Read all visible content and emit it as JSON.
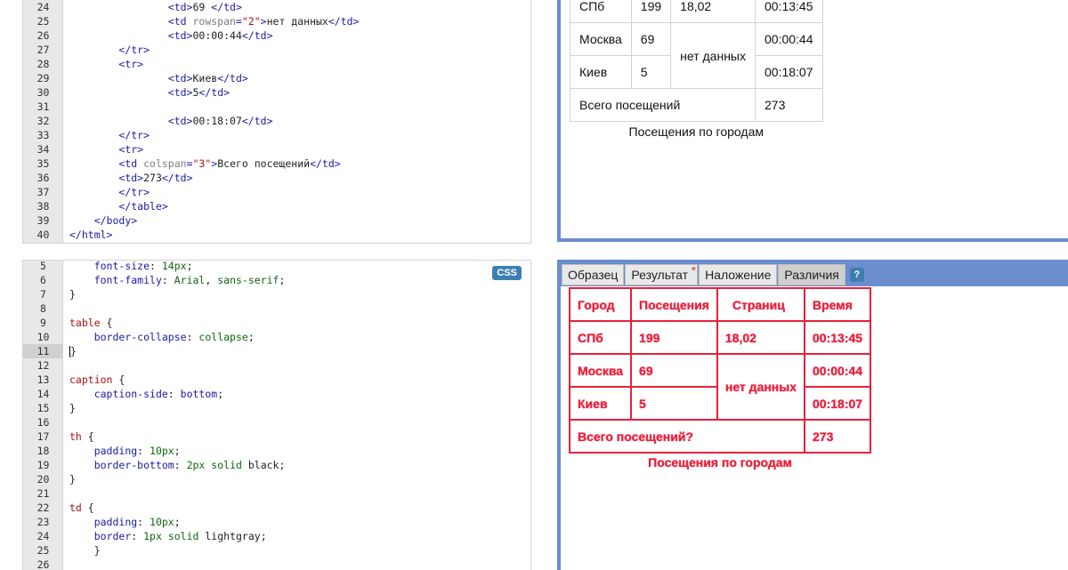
{
  "html_editor": {
    "lines": [
      {
        "n": "24",
        "indent": 4,
        "tokens": [
          [
            "tag",
            "<td>"
          ],
          [
            "text",
            "69 "
          ],
          [
            "tag",
            "</td>"
          ]
        ]
      },
      {
        "n": "25",
        "indent": 4,
        "tokens": [
          [
            "tag",
            "<td "
          ],
          [
            "attr",
            "rowspan"
          ],
          [
            "tag",
            "="
          ],
          [
            "str",
            "\"2\""
          ],
          [
            "tag",
            ">"
          ],
          [
            "text",
            "нет данных"
          ],
          [
            "tag",
            "</td>"
          ]
        ]
      },
      {
        "n": "26",
        "indent": 4,
        "tokens": [
          [
            "tag",
            "<td>"
          ],
          [
            "text",
            "00:00:44"
          ],
          [
            "tag",
            "</td>"
          ]
        ]
      },
      {
        "n": "27",
        "indent": 2,
        "tokens": [
          [
            "tag",
            "</tr>"
          ]
        ]
      },
      {
        "n": "28",
        "indent": 2,
        "tokens": [
          [
            "tag",
            "<tr>"
          ]
        ]
      },
      {
        "n": "29",
        "indent": 4,
        "tokens": [
          [
            "tag",
            "<td>"
          ],
          [
            "text",
            "Киев"
          ],
          [
            "tag",
            "</td>"
          ]
        ]
      },
      {
        "n": "30",
        "indent": 4,
        "tokens": [
          [
            "tag",
            "<td>"
          ],
          [
            "text",
            "5"
          ],
          [
            "tag",
            "</td>"
          ]
        ]
      },
      {
        "n": "31",
        "indent": 0,
        "tokens": []
      },
      {
        "n": "32",
        "indent": 4,
        "tokens": [
          [
            "tag",
            "<td>"
          ],
          [
            "text",
            "00:18:07"
          ],
          [
            "tag",
            "</td>"
          ]
        ]
      },
      {
        "n": "33",
        "indent": 2,
        "tokens": [
          [
            "tag",
            "</tr>"
          ]
        ]
      },
      {
        "n": "34",
        "indent": 2,
        "tokens": [
          [
            "tag",
            "<tr>"
          ]
        ]
      },
      {
        "n": "35",
        "indent": 2,
        "tokens": [
          [
            "tag",
            "<td "
          ],
          [
            "attr",
            "colspan"
          ],
          [
            "tag",
            "="
          ],
          [
            "str",
            "\"3\""
          ],
          [
            "tag",
            ">"
          ],
          [
            "text",
            "Всего посещений"
          ],
          [
            "tag",
            "</td>"
          ]
        ]
      },
      {
        "n": "36",
        "indent": 2,
        "tokens": [
          [
            "tag",
            "<td>"
          ],
          [
            "text",
            "273"
          ],
          [
            "tag",
            "</td>"
          ]
        ]
      },
      {
        "n": "37",
        "indent": 2,
        "tokens": [
          [
            "tag",
            "</tr>"
          ]
        ]
      },
      {
        "n": "38",
        "indent": 2,
        "tokens": [
          [
            "tag",
            "</table>"
          ]
        ]
      },
      {
        "n": "39",
        "indent": 1,
        "tokens": [
          [
            "tag",
            "</body>"
          ]
        ]
      },
      {
        "n": "40",
        "indent": 0,
        "tokens": [
          [
            "tag",
            "</html>"
          ]
        ]
      }
    ]
  },
  "css_editor": {
    "badge": "CSS",
    "active_line": "11",
    "lines": [
      {
        "n": "5",
        "indent": 1,
        "tokens": [
          [
            "prop",
            "font-size"
          ],
          [
            "text",
            ": "
          ],
          [
            "num",
            "14px"
          ],
          [
            "text",
            ";"
          ]
        ]
      },
      {
        "n": "6",
        "indent": 1,
        "tokens": [
          [
            "prop",
            "font-family"
          ],
          [
            "text",
            ": "
          ],
          [
            "kw",
            "Arial"
          ],
          [
            "text",
            ", "
          ],
          [
            "kw",
            "sans-serif"
          ],
          [
            "text",
            ";"
          ]
        ]
      },
      {
        "n": "7",
        "indent": 0,
        "tokens": [
          [
            "text",
            "}"
          ]
        ]
      },
      {
        "n": "8",
        "indent": 0,
        "tokens": []
      },
      {
        "n": "9",
        "indent": 0,
        "tokens": [
          [
            "sel",
            "table"
          ],
          [
            "text",
            " {"
          ]
        ]
      },
      {
        "n": "10",
        "indent": 1,
        "tokens": [
          [
            "prop",
            "border-collapse"
          ],
          [
            "text",
            ": "
          ],
          [
            "kw",
            "collapse"
          ],
          [
            "text",
            ";"
          ]
        ]
      },
      {
        "n": "11",
        "indent": 0,
        "tokens": [
          [
            "cursor",
            ""
          ],
          [
            "text",
            "}"
          ]
        ]
      },
      {
        "n": "12",
        "indent": 0,
        "tokens": []
      },
      {
        "n": "13",
        "indent": 0,
        "tokens": [
          [
            "sel",
            "caption"
          ],
          [
            "text",
            " {"
          ]
        ]
      },
      {
        "n": "14",
        "indent": 1,
        "tokens": [
          [
            "prop",
            "caption-side"
          ],
          [
            "text",
            ": "
          ],
          [
            "val",
            "bottom"
          ],
          [
            "text",
            ";"
          ]
        ]
      },
      {
        "n": "15",
        "indent": 0,
        "tokens": [
          [
            "text",
            "}"
          ]
        ]
      },
      {
        "n": "16",
        "indent": 0,
        "tokens": []
      },
      {
        "n": "17",
        "indent": 0,
        "tokens": [
          [
            "sel",
            "th"
          ],
          [
            "text",
            " {"
          ]
        ]
      },
      {
        "n": "18",
        "indent": 1,
        "tokens": [
          [
            "prop",
            "padding"
          ],
          [
            "text",
            ": "
          ],
          [
            "num",
            "10px"
          ],
          [
            "text",
            ";"
          ]
        ]
      },
      {
        "n": "19",
        "indent": 1,
        "tokens": [
          [
            "prop",
            "border-bottom"
          ],
          [
            "text",
            ": "
          ],
          [
            "num",
            "2px"
          ],
          [
            "text",
            " "
          ],
          [
            "kw",
            "solid"
          ],
          [
            "text",
            " black;"
          ]
        ]
      },
      {
        "n": "20",
        "indent": 0,
        "tokens": [
          [
            "text",
            "}"
          ]
        ]
      },
      {
        "n": "21",
        "indent": 0,
        "tokens": []
      },
      {
        "n": "22",
        "indent": 0,
        "tokens": [
          [
            "sel",
            "td"
          ],
          [
            "text",
            " {"
          ]
        ]
      },
      {
        "n": "23",
        "indent": 1,
        "tokens": [
          [
            "prop",
            "padding"
          ],
          [
            "text",
            ": "
          ],
          [
            "num",
            "10px"
          ],
          [
            "text",
            ";"
          ]
        ]
      },
      {
        "n": "24",
        "indent": 1,
        "tokens": [
          [
            "prop",
            "border"
          ],
          [
            "text",
            ": "
          ],
          [
            "num",
            "1px"
          ],
          [
            "text",
            " "
          ],
          [
            "kw",
            "solid"
          ],
          [
            "text",
            " lightgray;"
          ]
        ]
      },
      {
        "n": "25",
        "indent": 1,
        "tokens": [
          [
            "text",
            "}"
          ]
        ]
      },
      {
        "n": "26",
        "indent": 0,
        "tokens": []
      }
    ]
  },
  "preview": {
    "header": [
      "Город",
      "Посещения",
      "Страниц",
      "Время"
    ],
    "rows": {
      "spb": [
        "СПб",
        "199",
        "18,02",
        "00:13:45"
      ],
      "msk": [
        "Москва",
        "69",
        "нет данных",
        "00:00:44"
      ],
      "kiev": [
        "Киев",
        "5",
        "00:18:07"
      ]
    },
    "total_label": "Всего посещений",
    "total_value": "273",
    "caption": "Посещения по городам"
  },
  "diff": {
    "total_label": "Всего посещений?"
  },
  "tabs": {
    "sample": "Образец",
    "result": "Результат",
    "result_modified": "*",
    "overlay": "Наложение",
    "diff": "Различия",
    "help": "?"
  },
  "colors": {
    "pane_border": "#6a8ecf",
    "diff_red": "#e8203c",
    "badge_blue": "#3e7fb2"
  }
}
